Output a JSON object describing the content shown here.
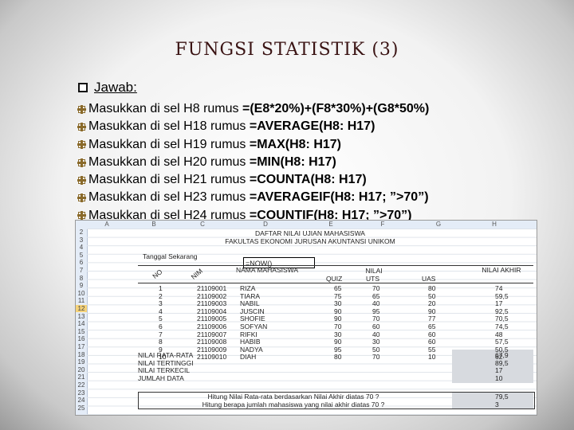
{
  "slide": {
    "title": "FUNGSI STATISTIK (3)",
    "jawab": "Jawab:",
    "lines": [
      {
        "pre": "Masukkan di sel ",
        "cell": "H8",
        "mid": " rumus ",
        "formula": "=(E8*20%)+(F8*30%)+(G8*50%)"
      },
      {
        "pre": "Masukkan di sel ",
        "cell": "H18",
        "mid": " rumus ",
        "formula": "=AVERAGE(H8: H17)"
      },
      {
        "pre": "Masukkan di sel ",
        "cell": "H19",
        "mid": " rumus ",
        "formula": "=MAX(H8: H17)"
      },
      {
        "pre": "Masukkan di sel ",
        "cell": "H20",
        "mid": " rumus ",
        "formula": "=MIN(H8: H17)"
      },
      {
        "pre": "Masukkan di sel ",
        "cell": "H21",
        "mid": " rumus ",
        "formula": "=COUNTA(H8: H17)"
      },
      {
        "pre": "Masukkan di sel ",
        "cell": "H23",
        "mid": " rumus ",
        "formula": "=AVERAGEIF(H8: H17; ”>70”)"
      },
      {
        "pre": "Masukkan di sel ",
        "cell": "H24",
        "mid": " rumus ",
        "formula": "=COUNTIF(H8: H17; ”>70”)"
      }
    ]
  },
  "sheet": {
    "columns": [
      "A",
      "B",
      "C",
      "D",
      "E",
      "F",
      "G",
      "H"
    ],
    "row_numbers": [
      "2",
      "3",
      "4",
      "5",
      "6",
      "7",
      "8",
      "9",
      "10",
      "11",
      "12",
      "13",
      "14",
      "15",
      "16",
      "17",
      "18",
      "19",
      "20",
      "21",
      "22",
      "23",
      "24",
      "25"
    ],
    "title1": "DAFTAR NILAI UJIAN MAHASISWA",
    "title2": "FAKULTAS EKONOMI JURUSAN AKUNTANSI UNIKOM",
    "tanggal": "Tanggal Sekarang",
    "now_formula": "=NOW()",
    "headers": {
      "no": "NO",
      "nim": "NIM",
      "nama": "NAMA MAHASISWA",
      "quiz": "QUIZ",
      "nilai": "NILAI",
      "uts": "UTS",
      "uas": "UAS",
      "akhir": "NILAI AKHIR"
    },
    "rows": [
      [
        "1",
        "21109001",
        "RIZA",
        "65",
        "70",
        "80",
        "74"
      ],
      [
        "2",
        "21109002",
        "TIARA",
        "75",
        "65",
        "50",
        "59,5"
      ],
      [
        "3",
        "21109003",
        "NABIL",
        "30",
        "40",
        "20",
        "17"
      ],
      [
        "4",
        "21109004",
        "JUSCIN",
        "90",
        "95",
        "90",
        "92,5"
      ],
      [
        "5",
        "21109005",
        "SHOFIE",
        "90",
        "70",
        "77",
        "70,5"
      ],
      [
        "6",
        "21109006",
        "SOFYAN",
        "70",
        "60",
        "65",
        "74,5"
      ],
      [
        "7",
        "21109007",
        "RIFKI",
        "30",
        "40",
        "60",
        "48"
      ],
      [
        "8",
        "21109008",
        "HABIB",
        "90",
        "30",
        "60",
        "57,5"
      ],
      [
        "9",
        "21109009",
        "NADYA",
        "95",
        "50",
        "55",
        "50,5"
      ],
      [
        "10",
        "21109010",
        "DIAH",
        "80",
        "70",
        "10",
        "62"
      ]
    ],
    "stats": [
      {
        "label": "NILAI RATA-RATA",
        "value": "67,9"
      },
      {
        "label": "NILAI TERTINGGI",
        "value": "89,5"
      },
      {
        "label": "NILAI TERKECIL",
        "value": "17"
      },
      {
        "label": "JUMLAH DATA",
        "value": "10"
      }
    ],
    "q1": {
      "label": "Hitung Nilai Rata-rata berdasarkan Nilai Akhir diatas 70 ?",
      "value": "79,5"
    },
    "q2": {
      "label": "Hitung berapa jumlah mahasiswa yang nilai akhir diatas 70 ?",
      "value": "3"
    }
  }
}
